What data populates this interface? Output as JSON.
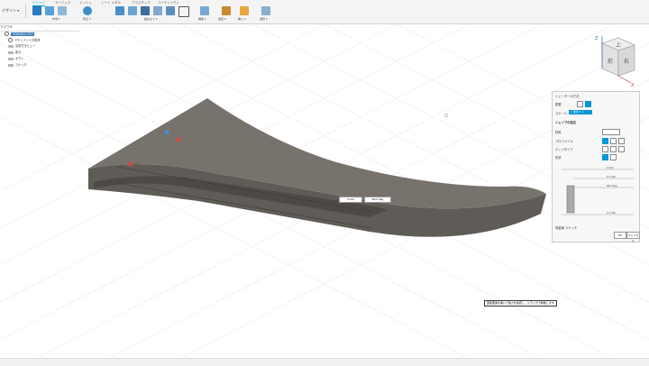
{
  "toolbar": {
    "workspace": "デザイン ▾",
    "tabs": [
      "ソリッド",
      "サーフェス",
      "メッシュ",
      "シート メタル",
      "プラスチック",
      "ユーティリティ"
    ],
    "groups": [
      "作成 ▾",
      "修正 ▾",
      "組み立て ▾",
      "構築 ▾",
      "検査 ▾",
      "挿入 ▾",
      "選択 ▾"
    ]
  },
  "browser": {
    "title": "ブラウザ",
    "items": [
      "shoehorn v4 ▾",
      "ドキュメントの設定",
      "名前付きビュー",
      "原点",
      "ボディ",
      "スケッチ"
    ]
  },
  "viewcube": {
    "top": "上",
    "front": "前",
    "right": "右"
  },
  "panel": {
    "title": "シェーダーの寸法",
    "rows": [
      "配置",
      "スケール",
      "シェイプの設定",
      "材料",
      "プロファイル",
      "エッジタイプ",
      "形状",
      "方向"
    ],
    "chip": "1 選択 0 ×",
    "dims": [
      "2 mm",
      "1.5 mm",
      "90.5 deg",
      "1.5 mm"
    ],
    "footer": "荷重線 スケッチ",
    "ok": "OK",
    "cancel": "キャンセル"
  },
  "canvas": {
    "dim_inputs": [
      "3 mm",
      "90.5 deg"
    ],
    "tooltip": "回転要素を開いて長さを指定し、ドラッグで移動します"
  },
  "colors": {
    "accent": "#0696d7",
    "body": "#6e6963",
    "body_top": "#807b74"
  }
}
